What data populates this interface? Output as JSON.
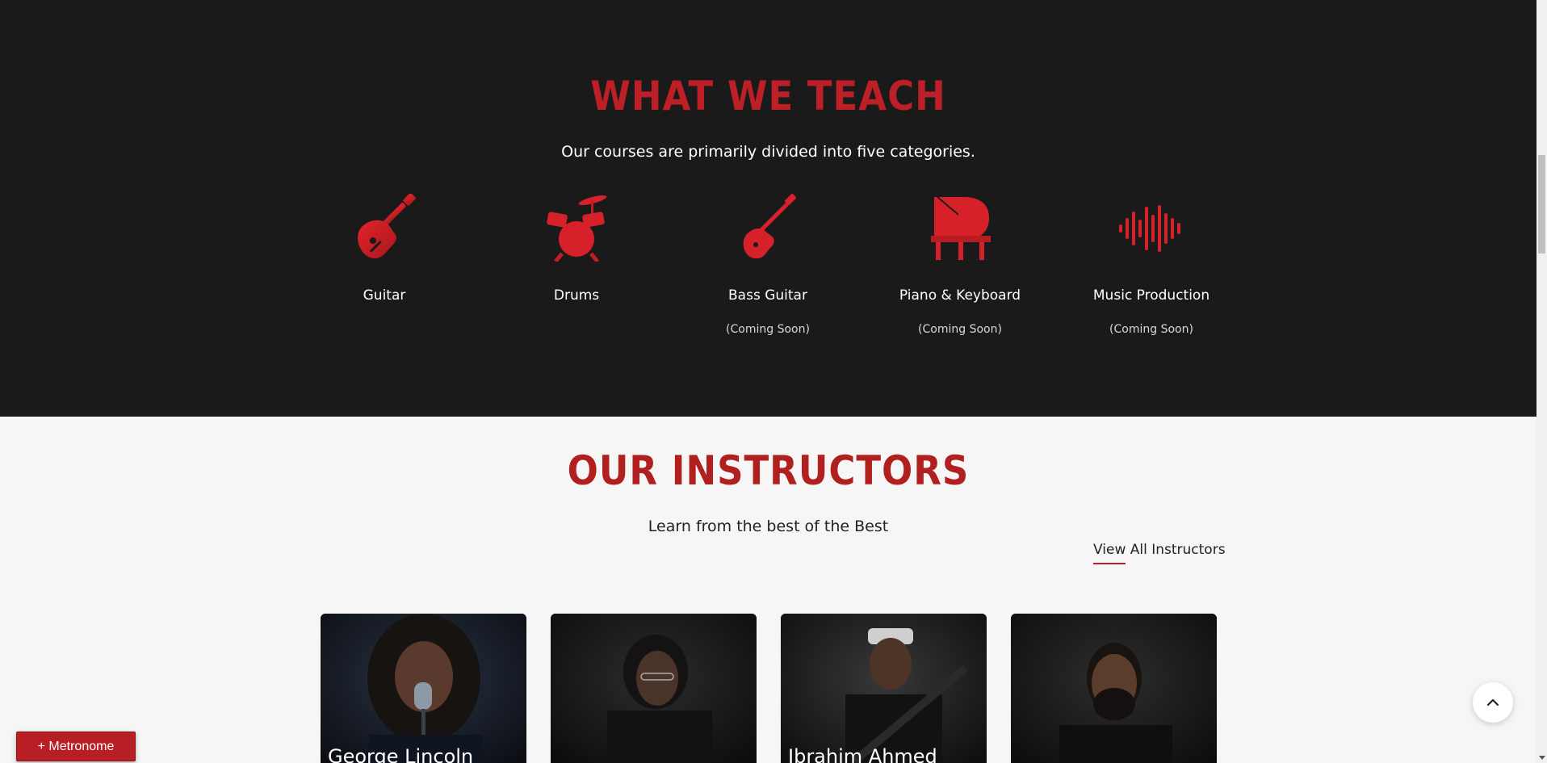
{
  "teach": {
    "title": "WHAT WE TEACH",
    "subtitle": "Our courses are primarily divided into five categories.",
    "categories": [
      {
        "name": "Guitar",
        "note": "",
        "icon": "electric-guitar-icon"
      },
      {
        "name": "Drums",
        "note": "",
        "icon": "drum-kit-icon"
      },
      {
        "name": "Bass Guitar",
        "note": "(Coming Soon)",
        "icon": "bass-guitar-icon"
      },
      {
        "name": "Piano & Keyboard",
        "note": "(Coming Soon)",
        "icon": "grand-piano-icon"
      },
      {
        "name": "Music Production",
        "note": "(Coming Soon)",
        "icon": "sound-wave-icon"
      }
    ]
  },
  "instructors": {
    "title": "OUR INSTRUCTORS",
    "subtitle": "Learn from the best of the Best",
    "view_all": "View All Instructors",
    "cards": [
      {
        "name": "George Lincoln"
      },
      {
        "name": ""
      },
      {
        "name": "Ibrahim Ahmed"
      },
      {
        "name": ""
      }
    ]
  },
  "metronome_button": "+ Metronome",
  "colors": {
    "accent": "#bd1f26",
    "dark_bg": "#1b1a1b",
    "light_bg": "#f6f6f6"
  }
}
